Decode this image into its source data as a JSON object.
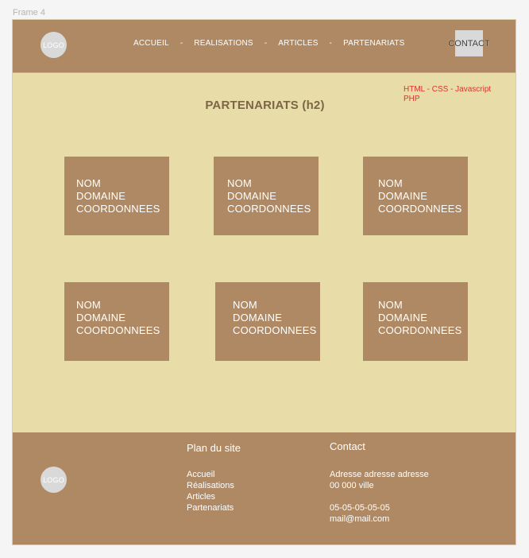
{
  "canvas": {
    "frame_label": "Frame 4"
  },
  "header": {
    "logo": "LOGO",
    "nav": [
      "ACCUEIL",
      "REALISATIONS",
      "ARTICLES",
      "PARTENARIATS"
    ],
    "separator": "-",
    "contact_button": "CONTACT"
  },
  "main": {
    "note_line1": "HTML - CSS - Javascript",
    "note_line2": "PHP",
    "title": "PARTENARIATS (h2)",
    "cards": [
      {
        "name": "NOM",
        "domain": "DOMAINE",
        "contact": "COORDONNEES"
      },
      {
        "name": "NOM",
        "domain": "DOMAINE",
        "contact": "COORDONNEES"
      },
      {
        "name": "NOM",
        "domain": "DOMAINE",
        "contact": "COORDONNEES"
      },
      {
        "name": "NOM",
        "domain": "DOMAINE",
        "contact": "COORDONNEES"
      },
      {
        "name": "NOM",
        "domain": "DOMAINE",
        "contact": "COORDONNEES"
      },
      {
        "name": "NOM",
        "domain": "DOMAINE",
        "contact": "COORDONNEES"
      }
    ]
  },
  "footer": {
    "logo": "LOGO",
    "plan_title": "Plan du site",
    "plan_links": [
      "Accueil",
      "Réalisations",
      "Articles",
      "Partenariats"
    ],
    "contact_title": "Contact",
    "address_line1": "Adresse adresse adresse",
    "address_line2": "00 000 ville",
    "phone": "05-05-05-05-05",
    "email": "mail@mail.com"
  },
  "colors": {
    "header_footer": "#ae8964",
    "page_background": "#e8dca9",
    "note_text": "#d8352a",
    "title_text": "#7b6646"
  }
}
